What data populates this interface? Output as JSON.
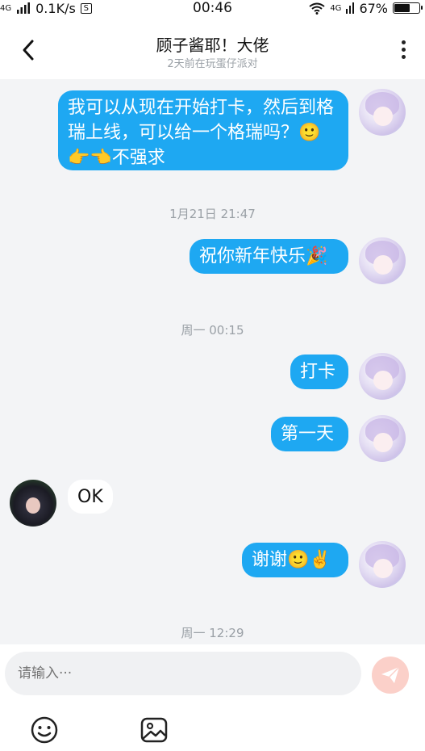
{
  "status_bar": {
    "network": "4G",
    "speed": "0.1K/s",
    "s_badge": "S",
    "time": "00:46",
    "network_right": "4G",
    "battery_percent": "67%",
    "battery_level": 0.67
  },
  "header": {
    "title": "顾子酱耶！大佬",
    "subtitle": "2天前在玩蛋仔派对"
  },
  "messages": {
    "m1": "我可以从现在开始打卡，然后到格瑞上线，可以给一个格瑞吗？🙂👉👈不强求",
    "ts1": "1月21日 21:47",
    "m2": "祝你新年快乐🎉",
    "ts2": "周一 00:15",
    "m3": "打卡",
    "m4": "第一天",
    "m5": "OK",
    "m6": "谢谢🙂✌️",
    "ts3": "周一 12:29"
  },
  "input": {
    "placeholder": "请输入···"
  },
  "icons": {
    "back": "chevron-left-icon",
    "more": "more-vertical-icon",
    "send": "send-icon",
    "emoji": "emoji-icon",
    "image": "image-icon"
  },
  "colors": {
    "bubble_self": "#1ea8f2",
    "bubble_other": "#ffffff",
    "send_disabled": "#fbd0c9"
  }
}
